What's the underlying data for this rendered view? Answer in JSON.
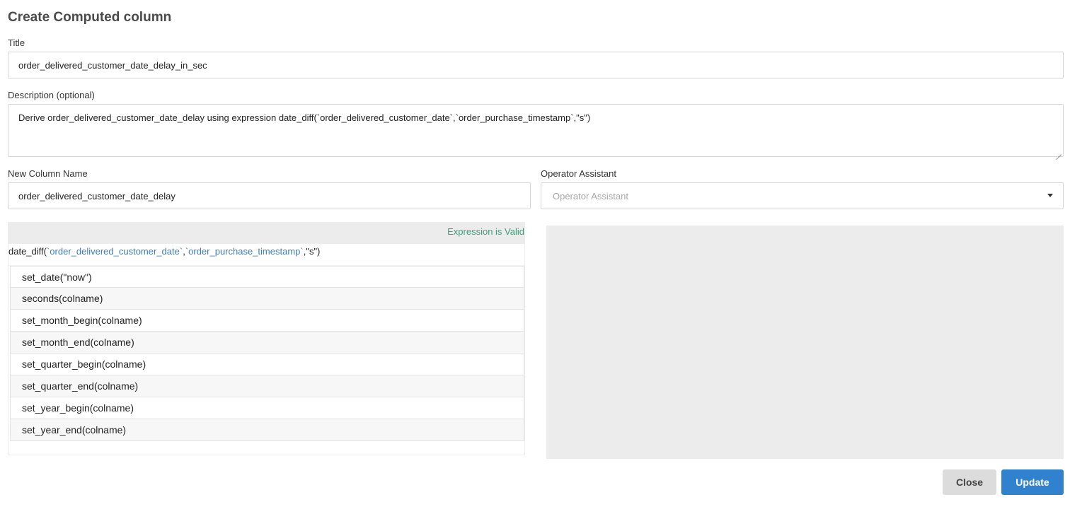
{
  "dialog": {
    "title": "Create Computed column",
    "close_label": "Close",
    "update_label": "Update"
  },
  "form": {
    "title_label": "Title",
    "title_value": "order_delivered_customer_date_delay_in_sec",
    "description_label": "Description (optional)",
    "description_value": "Derive order_delivered_customer_date_delay using expression date_diff(`order_delivered_customer_date`,`order_purchase_timestamp`,\"s\")",
    "column_name_label": "New Column Name",
    "column_name_value": "order_delivered_customer_date_delay",
    "operator_label": "Operator Assistant",
    "operator_placeholder": "Operator Assistant"
  },
  "editor": {
    "status": "Expression is Valid",
    "expr_prefix": "date_diff(",
    "expr_col1": "`order_delivered_customer_date`",
    "expr_sep": ",",
    "expr_col2": "`order_purchase_timestamp`",
    "expr_suffix": ",\"s\")",
    "suggestions": [
      "set_date(\"now\")",
      "seconds(colname)",
      "set_month_begin(colname)",
      "set_month_end(colname)",
      "set_quarter_begin(colname)",
      "set_quarter_end(colname)",
      "set_year_begin(colname)",
      "set_year_end(colname)"
    ]
  },
  "colors": {
    "valid": "#3e9d7a",
    "column_ref": "#3a7fc1",
    "primary": "#3182ce"
  }
}
